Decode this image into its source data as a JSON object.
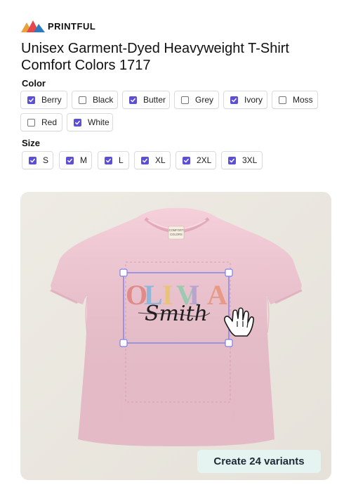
{
  "brand": {
    "name": "PRINTFUL"
  },
  "product": {
    "title_line1": "Unisex Garment-Dyed Heavyweight T-Shirt",
    "title_line2": "Comfort Colors 1717"
  },
  "color": {
    "label": "Color",
    "options": [
      {
        "label": "Berry",
        "checked": true
      },
      {
        "label": "Black",
        "checked": false
      },
      {
        "label": "Butter",
        "checked": true
      },
      {
        "label": "Grey",
        "checked": false
      },
      {
        "label": "Ivory",
        "checked": true
      },
      {
        "label": "Moss",
        "checked": false
      },
      {
        "label": "Red",
        "checked": false
      },
      {
        "label": "White",
        "checked": true
      }
    ]
  },
  "size": {
    "label": "Size",
    "options": [
      {
        "label": "S",
        "checked": true
      },
      {
        "label": "M",
        "checked": true
      },
      {
        "label": "L",
        "checked": true
      },
      {
        "label": "XL",
        "checked": true
      },
      {
        "label": "2XL",
        "checked": true
      },
      {
        "label": "3XL",
        "checked": true
      }
    ]
  },
  "mockup": {
    "shirt_color": "#f3c6d3",
    "tag_text_1": "COMFORT",
    "tag_text_2": "COLORS",
    "design_name": "OLIVIA",
    "design_surname": "Smith",
    "letter_colors": [
      "#e08a8a",
      "#8fb8d8",
      "#e8c478",
      "#9cc9b0",
      "#b9a3d3",
      "#e79a86"
    ],
    "selection_color": "#7f80e4"
  },
  "cta": {
    "label": "Create 24 variants"
  }
}
